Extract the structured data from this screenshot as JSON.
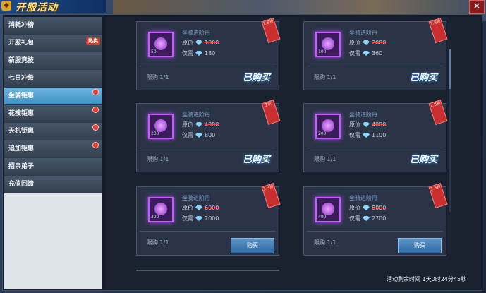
{
  "window": {
    "title": "开服活动",
    "close_label": "✕"
  },
  "sidebar": {
    "items": [
      {
        "label": "消耗冲榜"
      },
      {
        "label": "开服礼包",
        "tag": "热卖"
      },
      {
        "label": "新服竞技"
      },
      {
        "label": "七日冲级"
      },
      {
        "label": "坐骑钜惠"
      },
      {
        "label": "花搜钜惠"
      },
      {
        "label": "天机钜惠"
      },
      {
        "label": "追加钜惠"
      },
      {
        "label": "招亲弟子"
      },
      {
        "label": "充值回馈"
      }
    ]
  },
  "cards": [
    {
      "name": "坐骑进阶丹",
      "orig_label": "原价",
      "orig_value": "1000",
      "now_label": "仅需",
      "now_value": "180",
      "count": "50",
      "limit": "限购 1/1",
      "state_text": "已购买",
      "badge": "1.8折"
    },
    {
      "name": "坐骑进阶丹",
      "orig_label": "原价",
      "orig_value": "2000",
      "now_label": "仅需",
      "now_value": "360",
      "count": "100",
      "limit": "限购 1/1",
      "state_text": "已购买",
      "badge": "1.8折"
    },
    {
      "name": "坐骑进阶丹",
      "orig_label": "原价",
      "orig_value": "4000",
      "now_label": "仅需",
      "now_value": "800",
      "count": "200",
      "limit": "限购 1/1",
      "state_text": "已购买",
      "badge": "2折"
    },
    {
      "name": "坐骑进阶丹",
      "orig_label": "原价",
      "orig_value": "4000",
      "now_label": "仅需",
      "now_value": "1100",
      "count": "200",
      "limit": "限购 1/1",
      "state_text": "已购买",
      "badge": "2.8折"
    },
    {
      "name": "坐骑进阶丹",
      "orig_label": "原价",
      "orig_value": "6000",
      "now_label": "仅需",
      "now_value": "2000",
      "count": "300",
      "limit": "限购 1/1",
      "state_text": "购买",
      "badge": "3.3折"
    },
    {
      "name": "坐骑进阶丹",
      "orig_label": "原价",
      "orig_value": "8000",
      "now_label": "仅需",
      "now_value": "2700",
      "count": "400",
      "limit": "限购 1/1",
      "state_text": "购买",
      "badge": "3.3折"
    }
  ],
  "timer": "活动剩余时间 1天0时24分45秒"
}
